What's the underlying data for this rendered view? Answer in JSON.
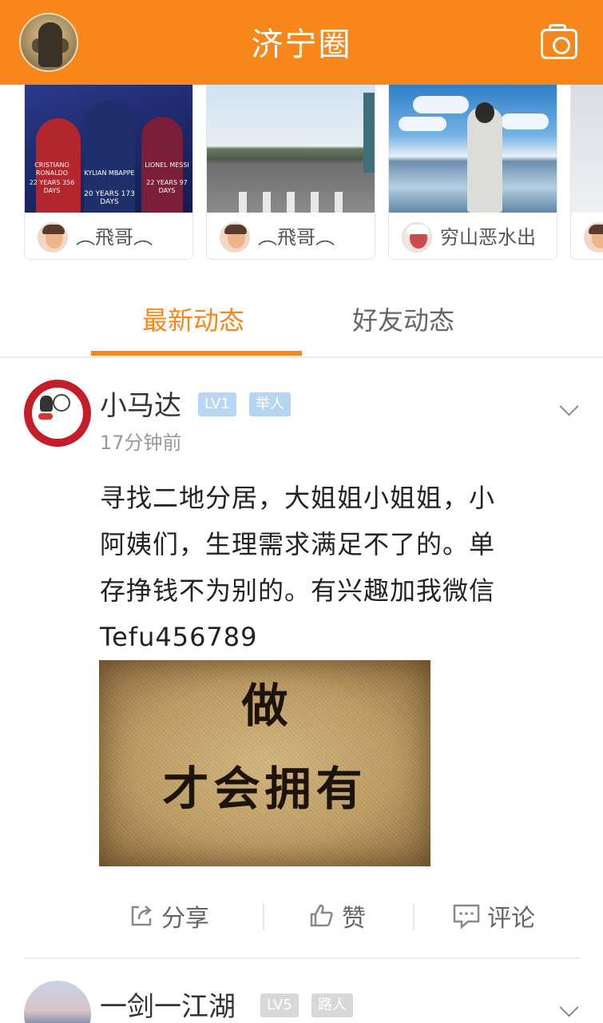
{
  "header": {
    "title": "济宁圈"
  },
  "carousel": {
    "cards": [
      {
        "author": "︵飛哥︵",
        "image_text": [
          "CRISTIANO RONALDO",
          "22 YEARS 356 DAYS",
          "KYLIAN MBAPPE",
          "LIONEL MESSI",
          "22 YEARS 97 DAYS",
          "20 YEARS 173 DAYS"
        ]
      },
      {
        "author": "︵飛哥︵"
      },
      {
        "author": "穷山恶水出"
      },
      {
        "author": ""
      }
    ]
  },
  "tabs": {
    "active": "最新动态",
    "friends": "好友动态"
  },
  "post": {
    "username": "小马达",
    "level": "LV1",
    "role": "举人",
    "time": "17分钟前",
    "text_lines": [
      "寻找二地分居，大姐姐小姐姐，小",
      "阿姨们，生理需求满足不了的。单",
      "存挣钱不为别的。有兴趣加我微信",
      "Tefu456789"
    ],
    "image_text": {
      "line1": "做",
      "line2": "才会拥有"
    },
    "actions": {
      "share": "分享",
      "like": "赞",
      "comment": "评论"
    }
  },
  "post2": {
    "username": "一剑一江湖",
    "level": "LV5",
    "role": "路人"
  },
  "colors": {
    "brand": "#f7861b",
    "badge_blue": "#b9d7f2",
    "badge_grey": "#d8d8d8"
  }
}
